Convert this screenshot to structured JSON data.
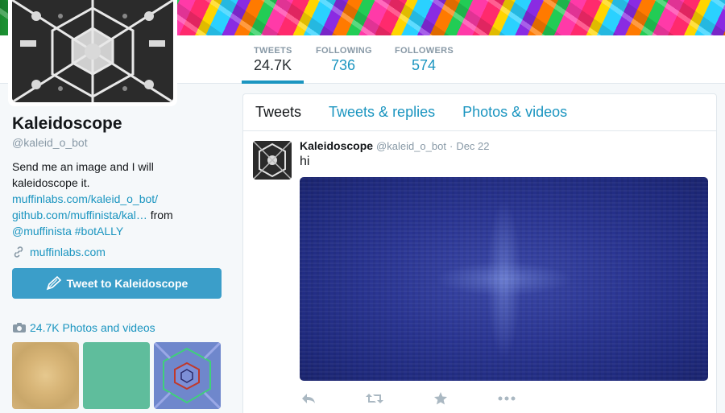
{
  "stats": [
    {
      "label": "TWEETS",
      "value": "24.7K"
    },
    {
      "label": "FOLLOWING",
      "value": "736"
    },
    {
      "label": "FOLLOWERS",
      "value": "574"
    }
  ],
  "profile": {
    "name": "Kaleidoscope",
    "handle": "@kaleid_o_bot",
    "bio_text": "Send me an image and I will kaleidoscope it.",
    "bio_link1": "muffinlabs.com/kaleid_o_bot/",
    "bio_link2": "github.com/muffinista/kal…",
    "bio_from": " from",
    "bio_mention": "@muffinista",
    "bio_hashtag": "#botALLY",
    "url": "muffinlabs.com",
    "tweet_to_label": "Tweet to Kaleidoscope",
    "media_label": "24.7K Photos and videos"
  },
  "timeline": {
    "tabs": [
      "Tweets",
      "Tweets & replies",
      "Photos & videos"
    ],
    "tweet": {
      "name": "Kaleidoscope",
      "handle": "@kaleid_o_bot",
      "dot": "·",
      "date": "Dec 22",
      "text": "hi"
    }
  },
  "icons": {
    "link": "link-icon",
    "camera": "camera-icon",
    "quill": "compose-icon",
    "reply": "reply-icon",
    "retweet": "retweet-icon",
    "favorite": "star-icon",
    "more": "more-icon"
  },
  "colors": {
    "accent": "#1b95c0",
    "button": "#3b9ec9",
    "muted": "#8899a6"
  }
}
